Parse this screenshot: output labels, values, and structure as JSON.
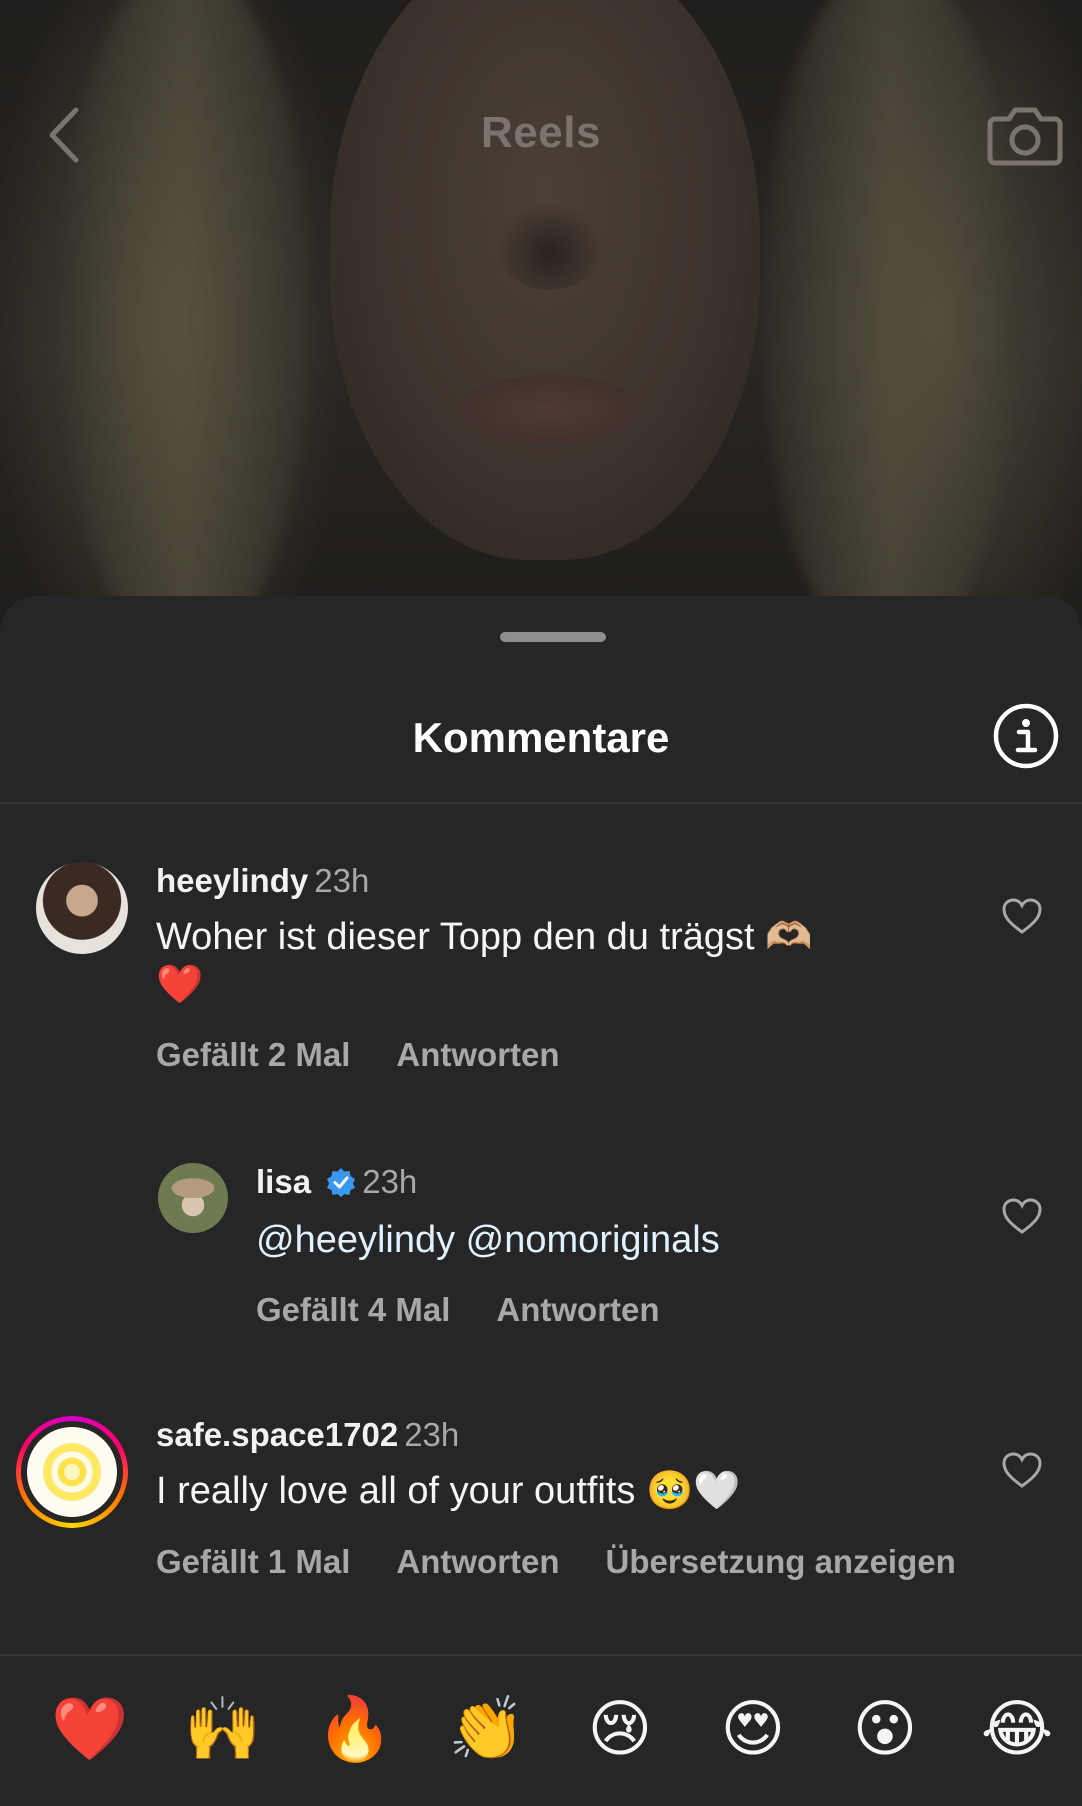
{
  "header": {
    "title": "Reels",
    "back_icon": "chevron-left-icon",
    "camera_icon": "camera-icon"
  },
  "sheet": {
    "title": "Kommentare",
    "info_icon": "info-icon"
  },
  "comments": [
    {
      "username": "heeylindy",
      "time": "23h",
      "text_line1": "Woher ist dieser Topp den du trägst 🫶🏼",
      "text_line2": "❤️",
      "likes": "Gefällt 2 Mal",
      "reply": "Antworten"
    },
    {
      "username": "lisa",
      "verified": true,
      "time": "23h",
      "text": "@heeylindy @nomoriginals",
      "likes": "Gefällt 4 Mal",
      "reply": "Antworten"
    },
    {
      "username": "safe.space1702",
      "time": "23h",
      "text": "I really love all of your outfits 🥹🤍",
      "likes": "Gefällt 1 Mal",
      "reply": "Antworten",
      "translate": "Übersetzung anzeigen"
    }
  ],
  "emoji_bar": [
    "❤️",
    "🙌",
    "🔥",
    "👏",
    "😢",
    "😍",
    "😮",
    "😂"
  ],
  "colors": {
    "sheet_bg": "#262626",
    "secondary_text": "#a8a8a8",
    "verified_blue": "#3897f0"
  }
}
